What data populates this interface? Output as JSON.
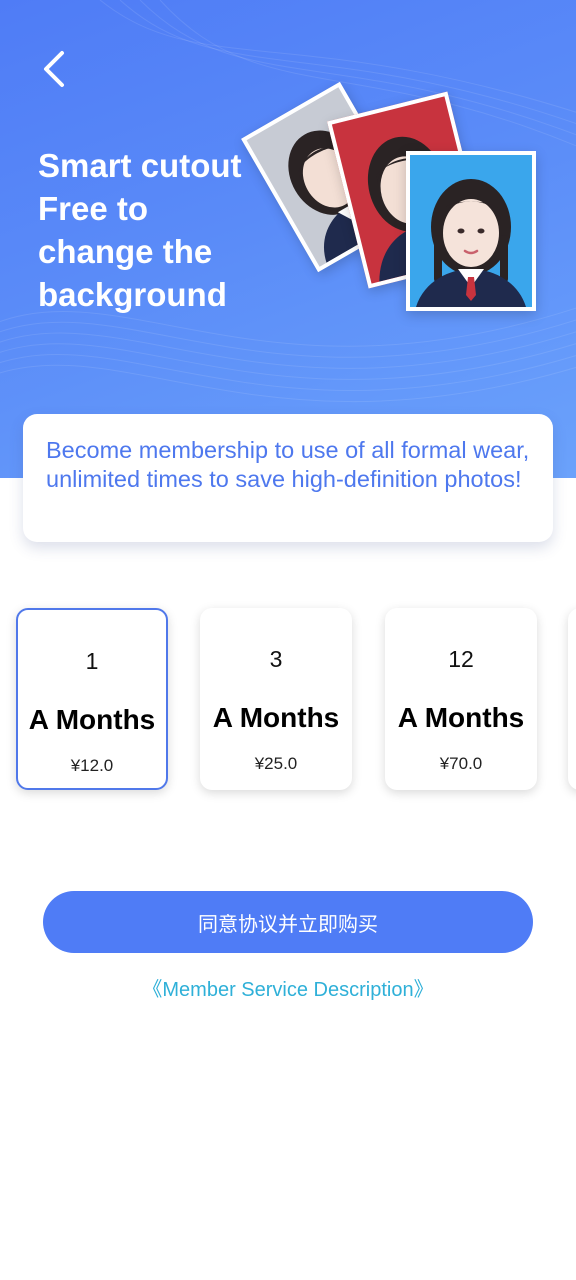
{
  "header": {
    "back_icon": "chevron-left-icon",
    "title": "Smart cutout\nFree to\nchange the\nbackground",
    "gradient_colors": [
      "#4f7cf6",
      "#6ba2fb"
    ]
  },
  "sample_photos": [
    {
      "background": "gray",
      "color": "#c7cbd4"
    },
    {
      "background": "red",
      "color": "#c8333e"
    },
    {
      "background": "blue",
      "color": "#3aa6ec"
    }
  ],
  "info": {
    "text": "Become membership to use of all formal wear, unlimited times to save high-definition photos!"
  },
  "plans": [
    {
      "count": "1",
      "unit": "A Months",
      "price": "¥12.0",
      "selected": true
    },
    {
      "count": "3",
      "unit": "A Months",
      "price": "¥25.0",
      "selected": false
    },
    {
      "count": "12",
      "unit": "A Months",
      "price": "¥70.0",
      "selected": false
    }
  ],
  "actions": {
    "buy_label": "同意协议并立即购买",
    "service_link": "《Member Service Description》"
  },
  "colors": {
    "accent": "#4f7cf6",
    "info_text": "#4e78ee",
    "link": "#2fb0d8",
    "selected_border": "#5078ea"
  }
}
